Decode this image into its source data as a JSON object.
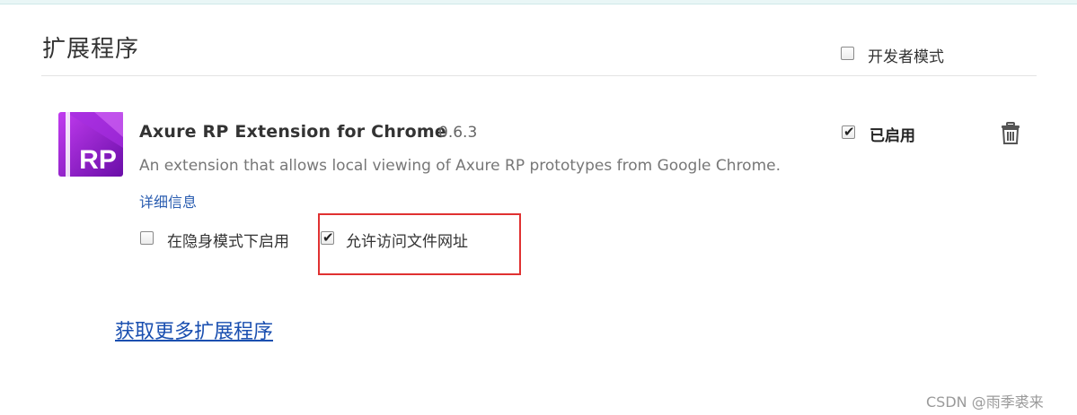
{
  "page": {
    "title": "扩展程序"
  },
  "developer_mode": {
    "label": "开发者模式",
    "checked": false
  },
  "extension": {
    "name": "Axure RP Extension for Chrome",
    "version": "0.6.3",
    "description": "An extension that allows local viewing of Axure RP prototypes from Google Chrome.",
    "details_link": "详细信息",
    "icon_text": "RP",
    "enabled_label": "已启用",
    "enabled": true,
    "incognito_label": "在隐身模式下启用",
    "incognito_checked": false,
    "file_urls_label": "允许访问文件网址",
    "file_urls_checked": true
  },
  "footer": {
    "more_extensions_link": "获取更多扩展程序"
  },
  "watermark": "CSDN @雨季裘来",
  "colors": {
    "link": "#2a5db0",
    "highlight": "#e03131",
    "icon_purple": "#8a1fc9"
  }
}
